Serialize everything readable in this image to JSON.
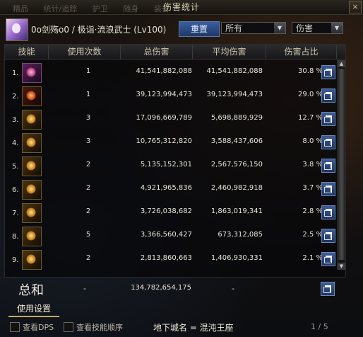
{
  "window": {
    "title": "伤害统计",
    "close_label": "×"
  },
  "top_tabs": [
    "精品",
    "统计/追踪",
    "护卫",
    "随身",
    "装备"
  ],
  "header": {
    "character": "0o剑殇o0 / 极诣·流浪武士 (Lv100)",
    "reset_label": "重置",
    "filter_target": "所有",
    "filter_type": "伤害"
  },
  "columns": [
    "技能",
    "使用次数",
    "总伤害",
    "平均伤害",
    "伤害占比"
  ],
  "rows": [
    {
      "rank": "1.",
      "count": "1",
      "total": "41,541,882,088",
      "avg": "41,541,882,088",
      "pct": "30.8 %"
    },
    {
      "rank": "2.",
      "count": "1",
      "total": "39,123,994,473",
      "avg": "39,123,994,473",
      "pct": "29.0 %"
    },
    {
      "rank": "3.",
      "count": "3",
      "total": "17,096,669,789",
      "avg": "5,698,889,929",
      "pct": "12.7 %"
    },
    {
      "rank": "4.",
      "count": "3",
      "total": "10,765,312,820",
      "avg": "3,588,437,606",
      "pct": "8.0 %"
    },
    {
      "rank": "5.",
      "count": "2",
      "total": "5,135,152,301",
      "avg": "2,567,576,150",
      "pct": "3.8 %"
    },
    {
      "rank": "6.",
      "count": "2",
      "total": "4,921,965,836",
      "avg": "2,460,982,918",
      "pct": "3.7 %"
    },
    {
      "rank": "7.",
      "count": "2",
      "total": "3,726,038,682",
      "avg": "1,863,019,341",
      "pct": "2.8 %"
    },
    {
      "rank": "8.",
      "count": "5",
      "total": "3,366,560,427",
      "avg": "673,312,085",
      "pct": "2.5 %"
    },
    {
      "rank": "9.",
      "count": "2",
      "total": "2,813,860,663",
      "avg": "1,406,930,331",
      "pct": "2.1 %"
    }
  ],
  "summary": {
    "label": "总和",
    "count": "-",
    "total": "134,782,654,175",
    "avg": "-"
  },
  "settings_tab": "使用设置",
  "footer": {
    "show_dps": "查看DPS",
    "show_order": "查看技能顺序",
    "dungeon": "地下城名 = 混沌王座",
    "page": "1 / 5"
  }
}
